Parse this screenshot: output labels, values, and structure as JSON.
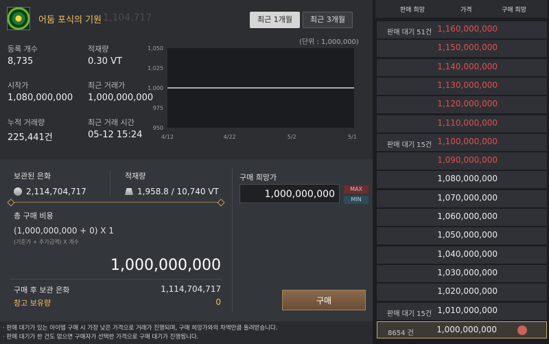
{
  "item": {
    "name": "어둠 포식의 기원",
    "ghost_value": "1,104,717"
  },
  "range_buttons": {
    "one_month": "최근 1개월",
    "three_months": "최근 3개월"
  },
  "stats": {
    "registered_label": "등록 개수",
    "registered_value": "8,735",
    "weight_label": "적재량",
    "weight_value": "0.30 VT",
    "start_price_label": "시작가",
    "start_price_value": "1,080,000,000",
    "recent_price_label": "최근 거래가",
    "recent_price_value": "1,000,000,000",
    "total_trades_label": "누적 거래량",
    "total_trades_value": "225,441건",
    "recent_time_label": "최근 거래 시간",
    "recent_time_value": "05-12 15:24"
  },
  "unit_note": "(단위 : 1,000,000)",
  "chart_data": {
    "type": "line",
    "x_ticks": [
      "4/12",
      "4/22",
      "5/2",
      "5/12"
    ],
    "y_ticks": [
      "1,050",
      "1,025",
      "1,000",
      "975",
      "950"
    ],
    "ylim": [
      950,
      1050
    ],
    "series": [
      {
        "values": [
          1000,
          1000,
          1000,
          1000
        ]
      }
    ],
    "line_color": "#ffffff"
  },
  "purchase": {
    "stored_silver_label": "보관된 은화",
    "stored_silver_value": "2,114,704,717",
    "weight_label": "적재량",
    "weight_value": "1,958.8 / 10,740 VT",
    "hope_price_label": "구매 희망가",
    "hope_price_value": "1,000,000,000",
    "max_label": "MAX",
    "min_label": "MIN",
    "total_label": "총 구매 비용",
    "formula": "(1,000,000,000 + 0) X 1",
    "formula_sub": "(기준가 + 추가금액) X 개수",
    "total_value": "1,000,000,000",
    "after_silver_label": "구매 후 보관 은화",
    "after_silver_value": "1,114,704,717",
    "storage_label": "창고 보유량",
    "storage_value": "0",
    "buy_button": "구매"
  },
  "notes": [
    "· 판매 대기가 있는 아이템 구매 시 가장 낮은 가격으로 거래가 진행되며, 구매 희망가와의 차액만큼 돌려받습니다.",
    "· 판매 대기가 한 건도 없으면 구매자가 선택한 가격으로 구매 대기가 진행됩니다."
  ],
  "order_book": {
    "headers": {
      "sell_hope": "판매 희망",
      "price": "가격",
      "buy_hope": "구매 희망"
    },
    "rows": [
      {
        "wait": "판매 대기 51건",
        "price": "1,160,000,000",
        "type": "sell"
      },
      {
        "wait": "",
        "price": "1,150,000,000",
        "type": "sell"
      },
      {
        "wait": "",
        "price": "1,140,000,000",
        "type": "sell"
      },
      {
        "wait": "",
        "price": "1,130,000,000",
        "type": "sell"
      },
      {
        "wait": "",
        "price": "1,120,000,000",
        "type": "sell"
      },
      {
        "wait": "",
        "price": "1,110,000,000",
        "type": "sell"
      },
      {
        "wait": "판매 대기 15건",
        "price": "1,100,000,000",
        "type": "sell"
      },
      {
        "wait": "",
        "price": "1,090,000,000",
        "type": "sell"
      },
      {
        "wait": "",
        "price": "1,080,000,000",
        "type": "buy"
      },
      {
        "wait": "",
        "price": "1,070,000,000",
        "type": "buy"
      },
      {
        "wait": "",
        "price": "1,060,000,000",
        "type": "buy"
      },
      {
        "wait": "",
        "price": "1,050,000,000",
        "type": "buy"
      },
      {
        "wait": "",
        "price": "1,040,000,000",
        "type": "buy"
      },
      {
        "wait": "",
        "price": "1,030,000,000",
        "type": "buy"
      },
      {
        "wait": "",
        "price": "1,020,000,000",
        "type": "buy"
      },
      {
        "wait": "판매 대기 15건",
        "price": "1,010,000,000",
        "type": "buy"
      },
      {
        "wait": "8654 건",
        "price": "1,000,000,000",
        "type": "buy",
        "highlight": true
      }
    ]
  }
}
